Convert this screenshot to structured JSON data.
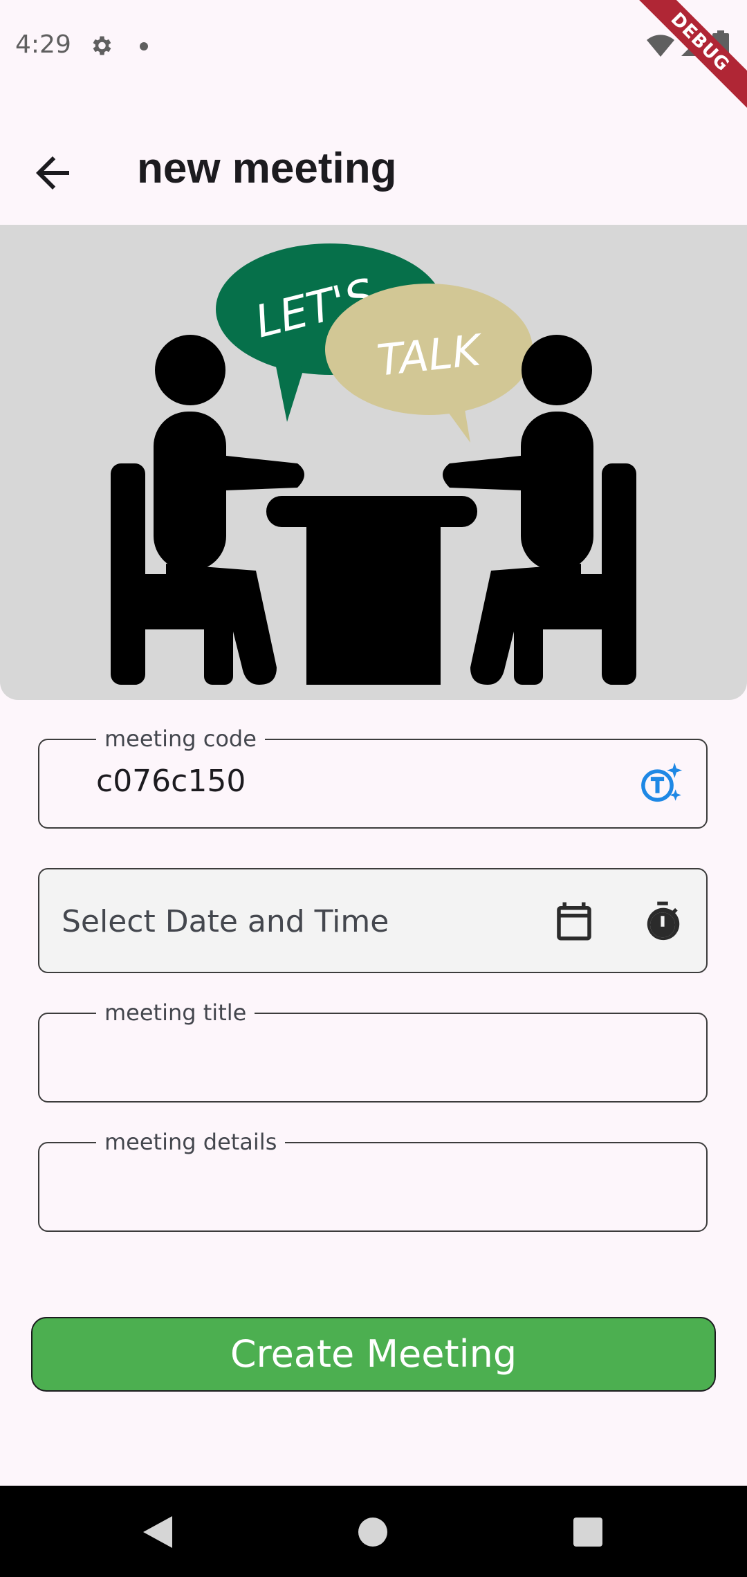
{
  "status_bar": {
    "time": "4:29",
    "icons": [
      "gear-icon",
      "notification-dot-icon",
      "wifi-icon",
      "signal-icon",
      "battery-icon"
    ]
  },
  "debug_banner": {
    "label": "DEBUG"
  },
  "app_bar": {
    "title": "new meeting",
    "back_icon": "arrow-left-icon"
  },
  "hero": {
    "bubble_left_text": "LET'S",
    "bubble_right_text": "TALK",
    "colors": {
      "background": "#d7d7d7",
      "bubble_left": "#06704a",
      "bubble_right": "#d2c795"
    }
  },
  "form": {
    "meeting_code": {
      "label": "meeting code",
      "value": "c076c150",
      "icon": "ai-generate-icon"
    },
    "date_time": {
      "placeholder": "Select Date and Time",
      "icons": [
        "calendar-icon",
        "timer-icon"
      ]
    },
    "meeting_title": {
      "label": "meeting title",
      "value": ""
    },
    "meeting_details": {
      "label": "meeting details",
      "value": ""
    }
  },
  "create_button": {
    "label": "Create Meeting",
    "color": "#4caf50"
  },
  "nav_bar": {
    "icons": [
      "back-triangle-icon",
      "home-circle-icon",
      "recents-square-icon"
    ]
  }
}
